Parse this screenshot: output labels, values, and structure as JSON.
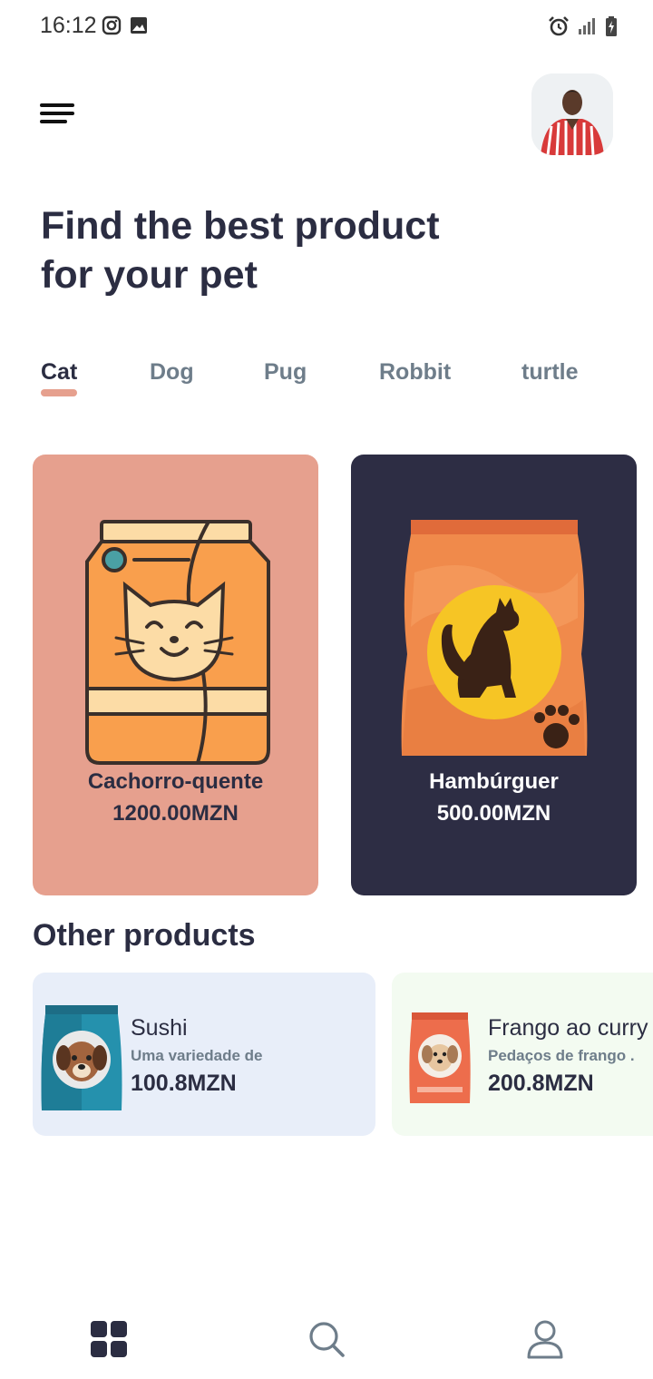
{
  "status_bar": {
    "time": "16:12",
    "left_icons": [
      "instagram-icon",
      "image-icon"
    ],
    "right_icons": [
      "alarm-icon",
      "signal-icon",
      "battery-icon"
    ]
  },
  "header": {
    "menu_icon": "menu-icon",
    "avatar": "user-avatar"
  },
  "headline": {
    "line1": "Find the best product",
    "line2": "for your pet"
  },
  "tabs": [
    {
      "label": "Cat",
      "active": true
    },
    {
      "label": "Dog",
      "active": false
    },
    {
      "label": "Pug",
      "active": false
    },
    {
      "label": "Robbit",
      "active": false
    },
    {
      "label": "turtle",
      "active": false
    }
  ],
  "colors": {
    "accent": "#e6a08e",
    "dark_card": "#2d2d44",
    "text_primary": "#2b2d42",
    "text_secondary": "#6e7d8a",
    "other_card_1": "#e8eef9",
    "other_card_2": "#f3fbf1"
  },
  "products": [
    {
      "name": "Cachorro-quente",
      "price": "1200.00MZN",
      "image": "cat-food-bag-icon"
    },
    {
      "name": "Hambúrguer",
      "price": "500.00MZN",
      "image": "cat-silhouette-bag-icon"
    }
  ],
  "other_section": {
    "title": "Other products",
    "items": [
      {
        "name": "Sushi",
        "description": "Uma variedade de",
        "price": "100.8MZN",
        "image": "dog-food-bag-icon"
      },
      {
        "name": "Frango ao curry",
        "description": "Pedaços de frango .",
        "price": "200.8MZN",
        "image": "dog-food-bag-icon"
      }
    ]
  },
  "bottom_nav": [
    {
      "icon": "grid-icon",
      "active": true
    },
    {
      "icon": "search-icon",
      "active": false
    },
    {
      "icon": "user-icon",
      "active": false
    }
  ]
}
